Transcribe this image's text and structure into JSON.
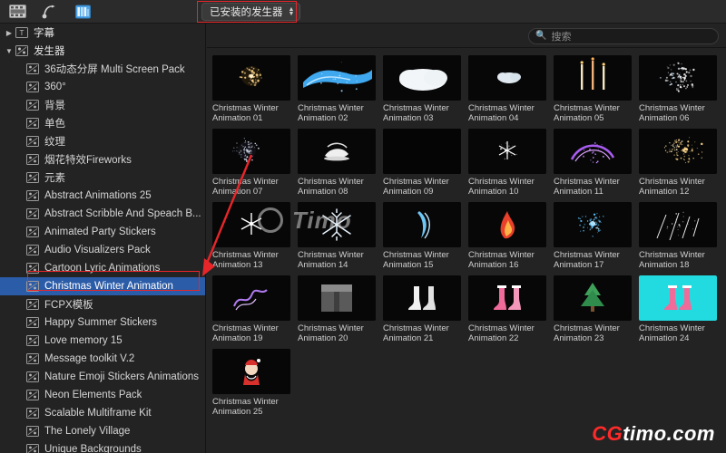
{
  "toolbar": {
    "icons": [
      {
        "name": "media-import-icon",
        "label": "媒体导入"
      },
      {
        "name": "keyframe-icon",
        "label": "关键帧"
      },
      {
        "name": "library-icon",
        "label": "资源库"
      }
    ],
    "popup": {
      "label": "已安装的发生器",
      "chevron": "⌃⌄"
    }
  },
  "search": {
    "placeholder": "搜索",
    "icon": "search-icon",
    "value": ""
  },
  "sidebar": {
    "items": [
      {
        "label": "字幕",
        "indent": 1,
        "disclosure": "▶",
        "icon": "titles-icon",
        "selected": false
      },
      {
        "label": "发生器",
        "indent": 1,
        "disclosure": "▼",
        "icon": "generators-icon",
        "selected": false
      },
      {
        "label": "36动态分屏 Multi Screen Pack",
        "indent": 2,
        "disclosure": "",
        "icon": "folder-icon",
        "selected": false
      },
      {
        "label": "360°",
        "indent": 2,
        "disclosure": "",
        "icon": "folder-icon",
        "selected": false
      },
      {
        "label": "背景",
        "indent": 2,
        "disclosure": "",
        "icon": "folder-icon",
        "selected": false
      },
      {
        "label": "单色",
        "indent": 2,
        "disclosure": "",
        "icon": "folder-icon",
        "selected": false
      },
      {
        "label": "纹理",
        "indent": 2,
        "disclosure": "",
        "icon": "folder-icon",
        "selected": false
      },
      {
        "label": "烟花特效Fireworks",
        "indent": 2,
        "disclosure": "",
        "icon": "folder-icon",
        "selected": false
      },
      {
        "label": "元素",
        "indent": 2,
        "disclosure": "",
        "icon": "folder-icon",
        "selected": false
      },
      {
        "label": "Abstract Animations 25",
        "indent": 2,
        "disclosure": "",
        "icon": "folder-icon",
        "selected": false
      },
      {
        "label": "Abstract Scribble And Speach B...",
        "indent": 2,
        "disclosure": "",
        "icon": "folder-icon",
        "selected": false
      },
      {
        "label": "Animated Party Stickers",
        "indent": 2,
        "disclosure": "",
        "icon": "folder-icon",
        "selected": false
      },
      {
        "label": "Audio Visualizers Pack",
        "indent": 2,
        "disclosure": "",
        "icon": "folder-icon",
        "selected": false
      },
      {
        "label": "Cartoon Lyric Animations",
        "indent": 2,
        "disclosure": "",
        "icon": "folder-icon",
        "selected": false
      },
      {
        "label": "Christmas Winter Animation",
        "indent": 2,
        "disclosure": "",
        "icon": "folder-icon",
        "selected": true
      },
      {
        "label": "FCPX模板",
        "indent": 2,
        "disclosure": "",
        "icon": "folder-icon",
        "selected": false
      },
      {
        "label": "Happy Summer Stickers",
        "indent": 2,
        "disclosure": "",
        "icon": "folder-icon",
        "selected": false
      },
      {
        "label": "Love memory 15",
        "indent": 2,
        "disclosure": "",
        "icon": "folder-icon",
        "selected": false
      },
      {
        "label": "Message toolkit V.2",
        "indent": 2,
        "disclosure": "",
        "icon": "folder-icon",
        "selected": false
      },
      {
        "label": "Nature Emoji Stickers Animations",
        "indent": 2,
        "disclosure": "",
        "icon": "folder-icon",
        "selected": false
      },
      {
        "label": "Neon Elements Pack",
        "indent": 2,
        "disclosure": "",
        "icon": "folder-icon",
        "selected": false
      },
      {
        "label": "Scalable Multiframe Kit",
        "indent": 2,
        "disclosure": "",
        "icon": "folder-icon",
        "selected": false
      },
      {
        "label": "The Lonely Village",
        "indent": 2,
        "disclosure": "",
        "icon": "folder-icon",
        "selected": false
      },
      {
        "label": "Unique Backgrounds",
        "indent": 2,
        "disclosure": "",
        "icon": "folder-icon",
        "selected": false
      }
    ]
  },
  "browser": {
    "items": [
      {
        "caption": "Christmas Winter Animation 01",
        "art": "sparkle-gold"
      },
      {
        "caption": "Christmas Winter Animation 02",
        "art": "blue-swash"
      },
      {
        "caption": "Christmas Winter Animation 03",
        "art": "white-cloud"
      },
      {
        "caption": "Christmas Winter Animation 04",
        "art": "small-cloud"
      },
      {
        "caption": "Christmas Winter Animation 05",
        "art": "candles"
      },
      {
        "caption": "Christmas Winter Animation 06",
        "art": "white-sparks"
      },
      {
        "caption": "Christmas Winter Animation 07",
        "art": "dark-burst"
      },
      {
        "caption": "Christmas Winter Animation 08",
        "art": "white-swirl"
      },
      {
        "caption": "Christmas Winter Animation 09",
        "art": "black-empty"
      },
      {
        "caption": "Christmas Winter Animation 10",
        "art": "white-flake"
      },
      {
        "caption": "Christmas Winter Animation 11",
        "art": "purple-arc"
      },
      {
        "caption": "Christmas Winter Animation 12",
        "art": "gold-dust"
      },
      {
        "caption": "Christmas Winter Animation 13",
        "art": "white-star"
      },
      {
        "caption": "Christmas Winter Animation 14",
        "art": "snowflake"
      },
      {
        "caption": "Christmas Winter Animation 15",
        "art": "blue-ribbon"
      },
      {
        "caption": "Christmas Winter Animation 16",
        "art": "red-flame"
      },
      {
        "caption": "Christmas Winter Animation 17",
        "art": "blue-burst"
      },
      {
        "caption": "Christmas Winter Animation 18",
        "art": "white-streaks"
      },
      {
        "caption": "Christmas Winter Animation 19",
        "art": "purple-squiggle"
      },
      {
        "caption": "Christmas Winter Animation 20",
        "art": "grey-block"
      },
      {
        "caption": "Christmas Winter Animation 21",
        "art": "white-socks"
      },
      {
        "caption": "Christmas Winter Animation 22",
        "art": "pink-socks"
      },
      {
        "caption": "Christmas Winter Animation 23",
        "art": "green-tree"
      },
      {
        "caption": "Christmas Winter Animation 24",
        "art": "cyan-socks"
      },
      {
        "caption": "Christmas Winter Animation 25",
        "art": "red-santa"
      }
    ]
  },
  "watermarks": {
    "center": "Timo",
    "bottom_cg": "CG",
    "bottom_timo": "timo.com"
  },
  "colors": {
    "selection": "#2b5ca8",
    "annotation": "#e8262a",
    "panel": "#232323",
    "toolbar": "#2b2b2b"
  }
}
